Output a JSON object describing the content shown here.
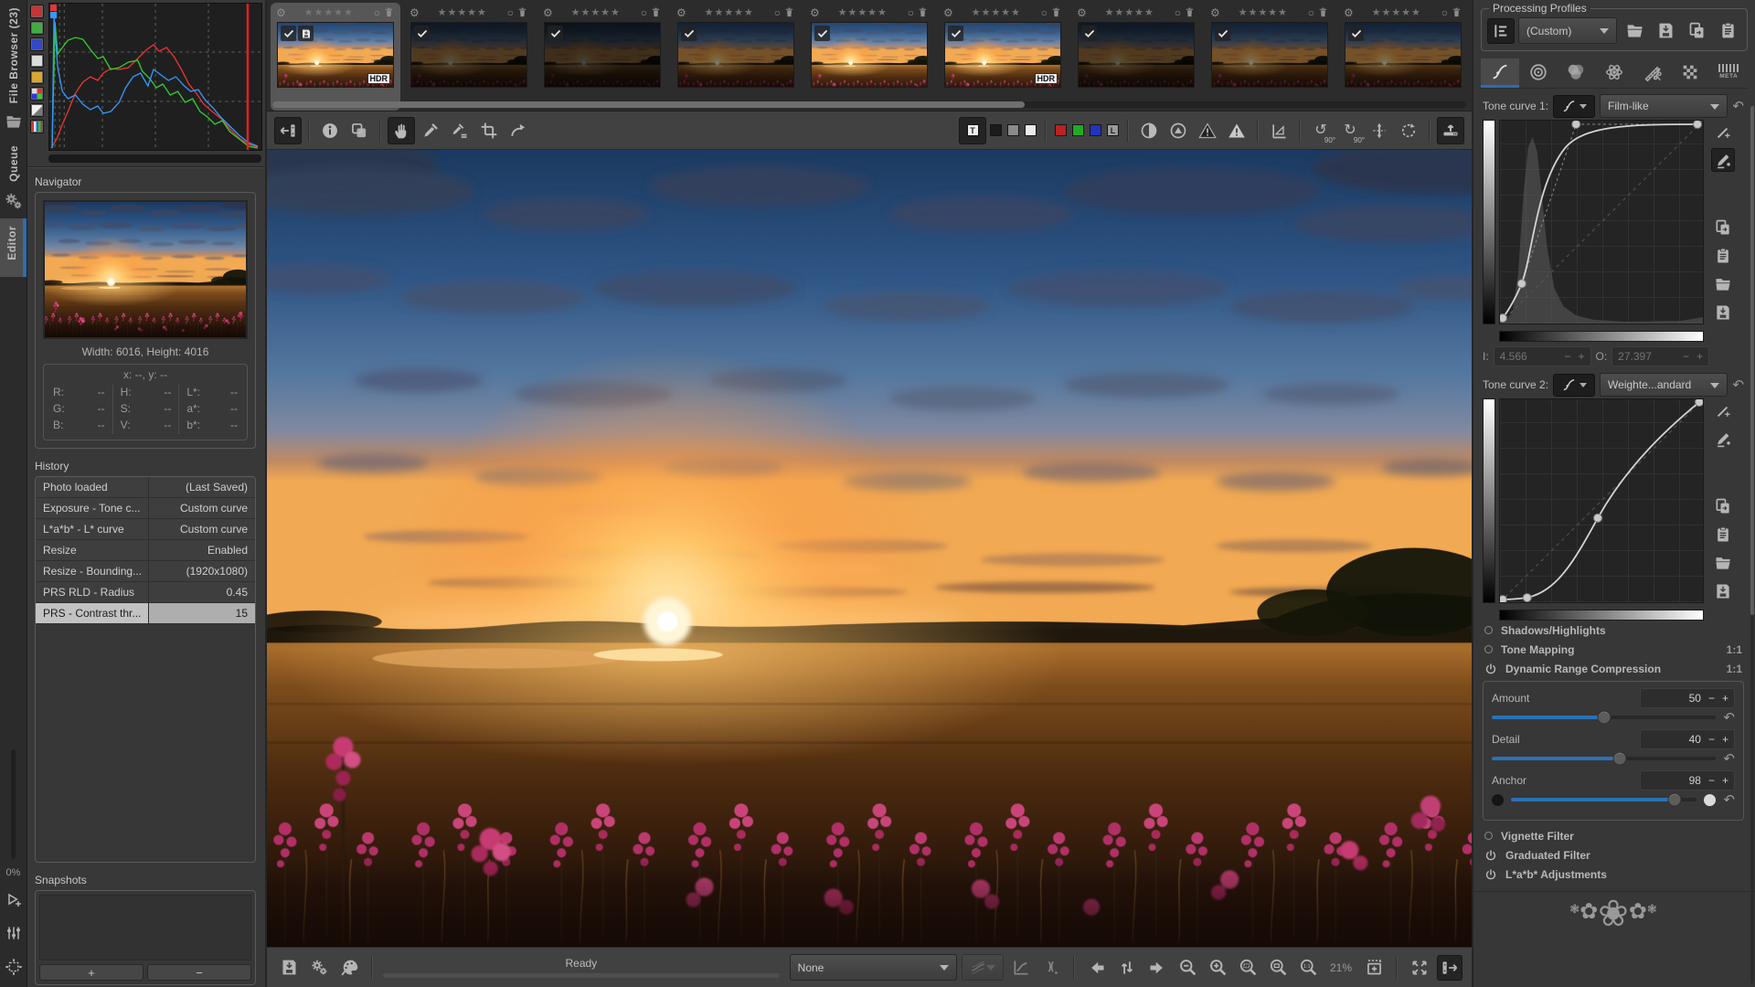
{
  "left_rail": {
    "file_browser": "File Browser (23)",
    "queue": "Queue",
    "editor": "Editor",
    "zoom_percent": "0%"
  },
  "navigator": {
    "title": "Navigator",
    "dimensions": "Width: 6016, Height: 4016",
    "cursor": "x: --, y: --",
    "values": [
      {
        "k": "R:",
        "v": "--"
      },
      {
        "k": "G:",
        "v": "--"
      },
      {
        "k": "B:",
        "v": "--"
      },
      {
        "k": "H:",
        "v": "--"
      },
      {
        "k": "S:",
        "v": "--"
      },
      {
        "k": "V:",
        "v": "--"
      },
      {
        "k": "L*:",
        "v": "--"
      },
      {
        "k": "a*:",
        "v": "--"
      },
      {
        "k": "b*:",
        "v": "--"
      }
    ]
  },
  "history": {
    "title": "History",
    "items": [
      {
        "label": "Photo loaded",
        "value": "(Last Saved)",
        "state": ""
      },
      {
        "label": "Exposure - Tone c...",
        "value": "Custom curve",
        "state": ""
      },
      {
        "label": "L*a*b* - L* curve",
        "value": "Custom curve",
        "state": ""
      },
      {
        "label": "Resize",
        "value": "Enabled",
        "state": ""
      },
      {
        "label": "Resize - Bounding...",
        "value": "(1920x1080)",
        "state": ""
      },
      {
        "label": "PRS RLD - Radius",
        "value": "0.45",
        "state": ""
      },
      {
        "label": "PRS - Contrast thr...",
        "value": "15",
        "state": "selected"
      }
    ]
  },
  "snapshots": {
    "title": "Snapshots",
    "add": "+",
    "remove": "−"
  },
  "filmstrip": {
    "stars": "★★★★★",
    "thumbs": [
      {
        "cls": "selected",
        "tone": "tone-bright",
        "hdr": "HDR",
        "saved": true
      },
      {
        "cls": "",
        "tone": "tone-dark"
      },
      {
        "cls": "",
        "tone": "tone-dark2"
      },
      {
        "cls": "",
        "tone": "tone-mid"
      },
      {
        "cls": "",
        "tone": "tone-bright"
      },
      {
        "cls": "",
        "tone": "tone-bright",
        "hdr": "HDR"
      },
      {
        "cls": "",
        "tone": "tone-dark"
      },
      {
        "cls": "",
        "tone": "tone-mid"
      },
      {
        "cls": "",
        "tone": "tone-mid"
      },
      {
        "cls": "",
        "tone": "tone-mid"
      }
    ]
  },
  "toolbar": {
    "rotate_left_deg": "90°",
    "rotate_right_deg": "90°",
    "bg_label": "T",
    "luma_label": "L"
  },
  "statusbar": {
    "ready": "Ready",
    "profile": "None",
    "zoom": "21%"
  },
  "right_panel": {
    "profiles": {
      "title": "Processing Profiles",
      "selected": "(Custom)"
    },
    "meta_label": "META",
    "tone_curve1": {
      "label": "Tone curve 1:",
      "mode": "Film-like"
    },
    "io": {
      "i_label": "I:",
      "i_value": "4.566",
      "o_label": "O:",
      "o_value": "27.397"
    },
    "tone_curve2": {
      "label": "Tone curve 2:",
      "mode": "Weighte...andard"
    },
    "sections": [
      {
        "label": "Shadows/Highlights",
        "badge": "",
        "is_radio": true
      },
      {
        "label": "Tone Mapping",
        "badge": "1:1",
        "is_radio": true
      },
      {
        "label": "Dynamic Range Compression",
        "badge": "1:1",
        "is_power": true
      }
    ],
    "drc_sliders": [
      {
        "label": "Amount",
        "value": "50",
        "pos": 50,
        "cls": ""
      },
      {
        "label": "Detail",
        "value": "40",
        "pos": 57,
        "cls": ""
      },
      {
        "label": "Anchor",
        "value": "98",
        "pos": 88,
        "cls": "anchor"
      }
    ],
    "sections_bottom": [
      {
        "label": "Vignette Filter",
        "is_radio": true
      },
      {
        "label": "Graduated Filter",
        "is_power": true
      },
      {
        "label": "L*a*b* Adjustments",
        "is_power": true
      }
    ]
  },
  "controls": {
    "minus": "−",
    "plus": "+",
    "reset": "↶",
    "circle": "○",
    "gear": "⚙",
    "rotate_left": "↺",
    "rotate_right": "↻",
    "flower_small": "❃",
    "flower_mid": "✿",
    "flower_big": "❀"
  }
}
